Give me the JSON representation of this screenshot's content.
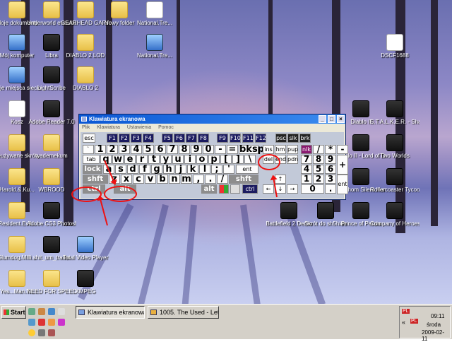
{
  "desktop": {
    "icons_left": [
      {
        "label": "Moje dokumenty",
        "kind": "folder"
      },
      {
        "label": "Mój komputer",
        "kind": "pc"
      },
      {
        "label": "Moje miejsca sieciowe",
        "kind": "pc"
      },
      {
        "label": "Kosz",
        "kind": "doc"
      },
      {
        "label": "Nieużywane skróty pulpitu",
        "kind": "folder"
      },
      {
        "label": "Harold.&.Ku...",
        "kind": "folder"
      },
      {
        "label": "Resident.Evil...",
        "kind": "folder"
      },
      {
        "label": "Slumdog.Milli...",
        "kind": "folder"
      },
      {
        "label": "Yes...Man.T...",
        "kind": "folder"
      }
    ],
    "icons_col2": [
      {
        "label": "Underworld evolution",
        "kind": "folder"
      },
      {
        "label": "Libra",
        "kind": "exe"
      },
      {
        "label": "LightScribe",
        "kind": "exe"
      },
      {
        "label": "Adobe Reader 7.0",
        "kind": "exe"
      },
      {
        "label": "wademekum",
        "kind": "folder"
      },
      {
        "label": "WBROOD",
        "kind": "folder"
      },
      {
        "label": "Adobe CS3 Photoshop...",
        "kind": "exe"
      },
      {
        "label": "shit_um_trailer",
        "kind": "exe"
      },
      {
        "label": "NEED FOR SPEED M...",
        "kind": "folder"
      }
    ],
    "icons_col3": [
      {
        "label": "GEARHEAD GARAGE",
        "kind": "folder"
      },
      {
        "label": "DIABLO 2 LOD",
        "kind": "folder"
      },
      {
        "label": "DIABLO 2",
        "kind": "folder"
      },
      {
        "label": "Total Video Player",
        "kind": "pc"
      },
      {
        "label": "XMPEG",
        "kind": "exe"
      }
    ],
    "icons_top": [
      {
        "label": "Nowy folder",
        "kind": "folder"
      },
      {
        "label": "National.Tre...",
        "kind": "doc"
      },
      {
        "label": "National.Tre...",
        "kind": "pc"
      }
    ],
    "icons_right": [
      {
        "label": "DSCF1688",
        "kind": "doc"
      },
      {
        "label": "Diablo II",
        "kind": "exe"
      },
      {
        "label": "S.T.A.L.K.E.R. - Shadow of...",
        "kind": "exe"
      },
      {
        "label": "Diablo II - Lord of Destruction",
        "kind": "exe"
      },
      {
        "label": "Two Worlds",
        "kind": "exe"
      },
      {
        "label": "Aruchom Silent Hunter 4 W...",
        "kind": "exe"
      },
      {
        "label": "Rollercoaster Tycoon 2",
        "kind": "exe"
      },
      {
        "label": "Battlefield 2 Demo",
        "kind": "exe"
      },
      {
        "label": "Skrót do sh5hide",
        "kind": "exe"
      },
      {
        "label": "Prince of Persia",
        "kind": "exe"
      },
      {
        "label": "Company of Heroes",
        "kind": "exe"
      }
    ]
  },
  "keyboard": {
    "title": "Klawiatura ekranowa",
    "menu": [
      "Plik",
      "Klawiatura",
      "Ustawienia",
      "Pomoc"
    ],
    "row1": [
      "esc",
      "F1",
      "F2",
      "F3",
      "F4",
      "F5",
      "F6",
      "F7",
      "F8",
      "F9",
      "F10",
      "F11",
      "F12",
      "psc",
      "slk",
      "brk"
    ],
    "row2": [
      "`",
      "1",
      "2",
      "3",
      "4",
      "5",
      "6",
      "7",
      "8",
      "9",
      "0",
      "-",
      "=",
      "bksp",
      "ins",
      "hm",
      "pup",
      "nlk",
      "/",
      "*",
      "-"
    ],
    "row3": [
      "tab",
      "q",
      "w",
      "e",
      "r",
      "t",
      "y",
      "u",
      "i",
      "o",
      "p",
      "[",
      "]",
      "\\",
      "del",
      "end",
      "pdn",
      "7",
      "8",
      "9",
      "+"
    ],
    "row4": [
      "lock",
      "a",
      "s",
      "d",
      "f",
      "g",
      "h",
      "j",
      "k",
      "l",
      ";",
      "'",
      "ent",
      "4",
      "5",
      "6"
    ],
    "row5": [
      "shft",
      "z",
      "x",
      "c",
      "v",
      "b",
      "n",
      "m",
      ",",
      ".",
      "/",
      "shft",
      "↑",
      "1",
      "2",
      "3",
      "ent"
    ],
    "row6": [
      "ctrl",
      "alt",
      "alt",
      "ctrl",
      "←",
      "↓",
      "→",
      "0",
      "."
    ]
  },
  "taskbar": {
    "start_label": "Start",
    "tasks": [
      "Klawiatura ekranowa",
      "1005. The Used - Let It ..."
    ],
    "clock": "09:11",
    "day": "środa",
    "date": "2009-02-11",
    "tray_labels": [
      "PL",
      "«"
    ]
  },
  "colors": {
    "title_bar": "#0a57d4",
    "annotation": "#e11111"
  }
}
